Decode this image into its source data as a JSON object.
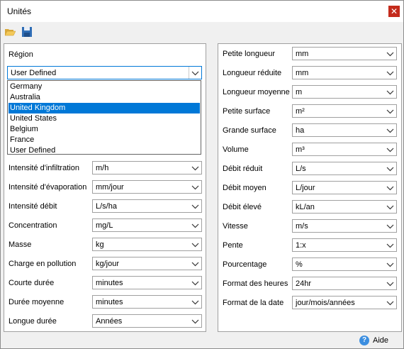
{
  "window": {
    "title": "Unités",
    "close_glyph": "✕"
  },
  "toolbar": {
    "open_icon": "folder-open-icon",
    "save_icon": "save-disk-icon"
  },
  "left": {
    "region_label": "Région",
    "region_value": "User Defined",
    "region_options": [
      "Germany",
      "Australia",
      "United Kingdom",
      "United States",
      "Belgium",
      "France",
      "User Defined"
    ],
    "region_highlighted": "United Kingdom",
    "rows": [
      {
        "label": "Intensité d'infiltration",
        "value": "m/h"
      },
      {
        "label": "Intensité d'évaporation",
        "value": "mm/jour"
      },
      {
        "label": "Intensité débit",
        "value": "L/s/ha"
      },
      {
        "label": "Concentration",
        "value": "mg/L"
      },
      {
        "label": "Masse",
        "value": "kg"
      },
      {
        "label": "Charge en pollution",
        "value": "kg/jour"
      },
      {
        "label": "Courte durée",
        "value": "minutes"
      },
      {
        "label": "Durée moyenne",
        "value": "minutes"
      },
      {
        "label": "Longue durée",
        "value": "Années"
      }
    ]
  },
  "right": {
    "rows": [
      {
        "label": "Petite longueur",
        "value": "mm"
      },
      {
        "label": "Longueur réduite",
        "value": "mm"
      },
      {
        "label": "Longueur moyenne",
        "value": "m"
      },
      {
        "label": "Petite surface",
        "value": "m²"
      },
      {
        "label": "Grande surface",
        "value": "ha"
      },
      {
        "label": "Volume",
        "value": "m³"
      },
      {
        "label": "Débit réduit",
        "value": "L/s"
      },
      {
        "label": "Débit moyen",
        "value": "L/jour"
      },
      {
        "label": "Débit élevé",
        "value": "kL/an"
      },
      {
        "label": "Vitesse",
        "value": "m/s"
      },
      {
        "label": "Pente",
        "value": "1:x"
      },
      {
        "label": "Pourcentage",
        "value": "%"
      },
      {
        "label": "Format des heures",
        "value": "24hr"
      },
      {
        "label": "Format de la date",
        "value": "jour/mois/années"
      }
    ]
  },
  "footer": {
    "help_label": "Aide",
    "help_icon": "question-icon"
  }
}
